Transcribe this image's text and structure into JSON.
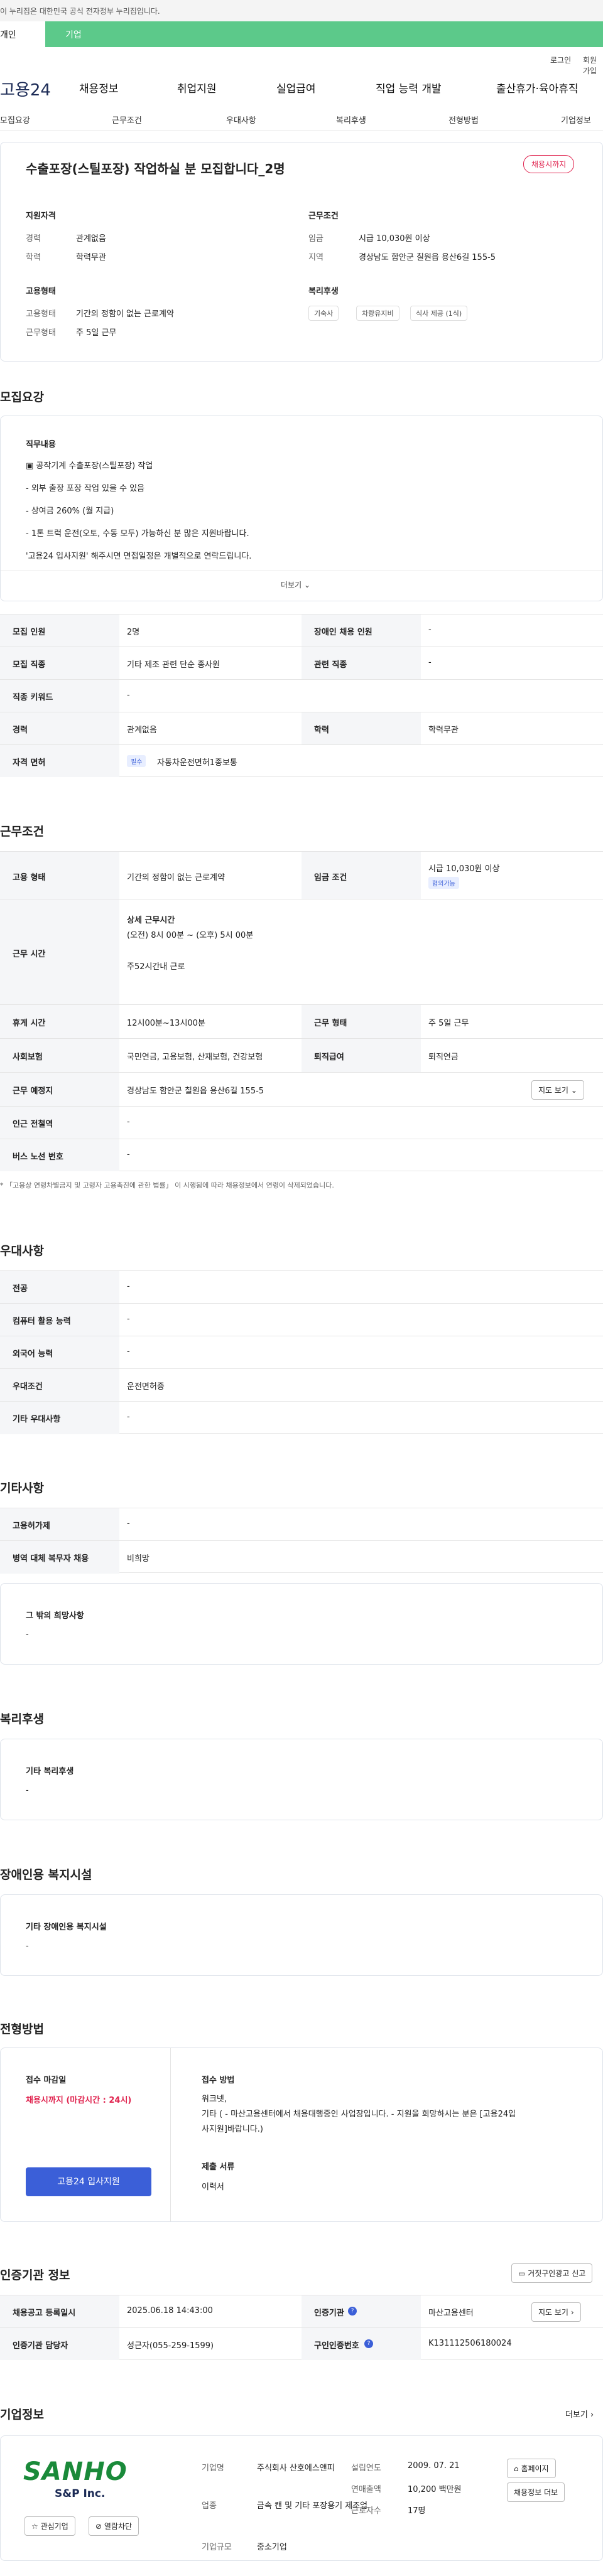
{
  "banner": {
    "text": "이 누리집은 대한민국 공식 전자정부 누리집입니다."
  },
  "tabs": {
    "a": "개인",
    "b": "기업"
  },
  "util": {
    "login": "로그인",
    "join": "회원가입"
  },
  "gnb": {
    "logo": "고용24",
    "menu": [
      "채용정보",
      "취업지원",
      "실업급여",
      "직업 능력 개발",
      "출산휴가·육아휴직"
    ]
  },
  "subnav": [
    "모집요강",
    "근무조건",
    "우대사항",
    "복리후생",
    "전형방법",
    "기업정보"
  ],
  "summary": {
    "title": "수출포장(스틸포장) 작업하실 분 모집합니다_2명",
    "badge": "채용시까지",
    "qual_h": "지원자격",
    "exp_l": "경력",
    "exp_v": "관계없음",
    "edu_l": "학력",
    "edu_v": "학력무관",
    "type_h": "고용형태",
    "type_l": "고용형태",
    "type_v": "기간의 정함이 없는 근로계약",
    "shift_l": "근무형태",
    "shift_v": "주 5일 근무",
    "cond_h": "근무조건",
    "wage_l": "임금",
    "wage_v": "시급 10,030원 이상",
    "loc_l": "지역",
    "loc_v": "경상남도 함안군 칠원읍 용산6길 155-5",
    "wel_h": "복리후생",
    "chips": [
      "기숙사",
      "차량유지비",
      "식사 제공 (1식)"
    ]
  },
  "recruit": {
    "title": "모집요강",
    "duty_h": "직무내용",
    "lines": [
      "▣ 공작기계 수출포장(스틸포장) 작업",
      "- 외부 출장 포장 작업 있을 수 있음",
      "- 상여금 260% (월 지급)",
      "- 1톤 트럭 운전(오토, 수동 모두) 가능하신 분 많은 지원바랍니다.",
      "'고용24 입사지원' 해주시면 면접일정은 개별적으로 연락드립니다."
    ],
    "more": "더보기",
    "rows": [
      [
        "모집 인원",
        "2명",
        "장애인 채용 인원",
        "-"
      ],
      [
        "모집 직종",
        "기타 제조 관련 단순 종사원",
        "관련 직종",
        "-"
      ],
      [
        "직종 키워드",
        "-",
        "",
        ""
      ],
      [
        "경력",
        "관계없음",
        "학력",
        "학력무관"
      ]
    ],
    "license_l": "자격 면허",
    "license_tag": "필수",
    "license_v": "자동차운전면허1종보통"
  },
  "work": {
    "title": "근무조건",
    "type_l": "고용 형태",
    "type_v": "기간의 정함이 없는 근로계약",
    "wage_l": "임금 조건",
    "wage_v": "시급 10,030원 이상",
    "wage_tag": "협의가능",
    "time_l": "근무 시간",
    "time_h": "상세 근무시간",
    "time_v": "(오전) 8시 00분 ~ (오후) 5시 00분",
    "time_w": "주52시간내 근로",
    "rows": [
      [
        "휴게 시간",
        "12시00분~13시00분",
        "근무 형태",
        "주 5일 근무"
      ],
      [
        "사회보험",
        "국민연금, 고용보험, 산재보험, 건강보험",
        "퇴직급여",
        "퇴직연금"
      ]
    ],
    "place_l": "근무 예정지",
    "place_v": "경상남도 함안군 칠원읍 용산6길 155-5",
    "map": "지도 보기",
    "sub_l": "인근 전철역",
    "sub_v": "-",
    "bus_l": "버스 노선 번호",
    "bus_v": "-",
    "note": "「고용상 연령차별금지 및 고령자 고용촉진에 관한 법률」 이 시행됨에 따라 채용정보에서 연령이 삭제되었습니다."
  },
  "pref": {
    "title": "우대사항",
    "rows": [
      [
        "전공",
        "-"
      ],
      [
        "컴퓨터 활용 능력",
        "-"
      ],
      [
        "외국어 능력",
        "-"
      ],
      [
        "우대조건",
        "운전면허증"
      ],
      [
        "기타 우대사항",
        "-"
      ]
    ]
  },
  "etc": {
    "title": "기타사항",
    "rows": [
      [
        "고용허가제",
        "-"
      ],
      [
        "병역 대체 복무자 채용",
        "비희망"
      ]
    ],
    "box_h": "그 밖의 희망사항",
    "box_v": "-"
  },
  "welfare": {
    "title": "복리후생",
    "box_h": "기타 복리후생",
    "box_v": "-"
  },
  "disab": {
    "title": "장애인용 복지시설",
    "box_h": "기타 장애인용 복지시설",
    "box_v": "-"
  },
  "select": {
    "title": "전형방법",
    "deadline_h": "접수 마감일",
    "deadline_v": "채용시까지 (마감시간 : 24시)",
    "method_h": "접수 방법",
    "method_v1": "워크넷,",
    "method_v2": "기타 ( - 마산고용센터에서 채용대행중인 사업장입니다. - 지원을 희망하시는 분은 [고용24입",
    "method_v3": "사지원]바랍니다.)",
    "docs_h": "제출 서류",
    "docs_v": "이력서",
    "apply": "고용24 입사지원"
  },
  "agency": {
    "title": "인증기관 정보",
    "report": "거짓구인광고 신고",
    "rows": [
      [
        "채용공고 등록일시",
        "2025.06.18 14:43:00",
        "인증기관",
        "마산고용센터"
      ],
      [
        "인증기관 담당자",
        "성근자(055-259-1599)",
        "구인인증번호",
        "K131112506180024"
      ]
    ],
    "map": "지도 보기"
  },
  "company": {
    "title": "기업정보",
    "more": "더보기",
    "logo1": "SANHO",
    "logo2": "S&P Inc.",
    "fav": "관심기업",
    "block": "열람차단",
    "f": [
      [
        "기업명",
        "주식회사 산호에스앤피"
      ],
      [
        "업종",
        "금속 캔 및 기타 포장용기 제조업"
      ],
      [
        "기업규모",
        "중소기업"
      ]
    ],
    "g": [
      [
        "설립연도",
        "2009. 07. 21"
      ],
      [
        "연매출액",
        "10,200 백만원"
      ],
      [
        "근로자수",
        "17명"
      ]
    ],
    "home": "홈페이지",
    "list": "채용정보 더보"
  },
  "colors": {
    "green": "#5cc98a",
    "red": "#e0234e",
    "blue": "#3b5fd8",
    "navy": "#1b2a55"
  }
}
